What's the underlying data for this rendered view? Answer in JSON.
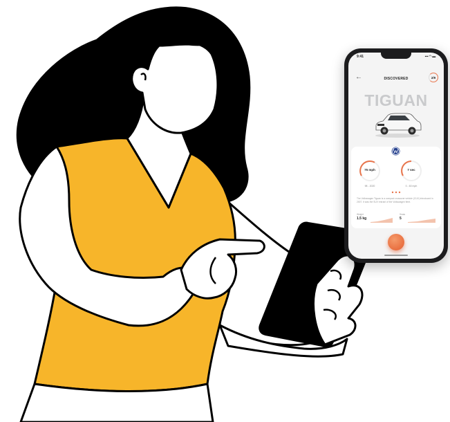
{
  "phone": {
    "status_time": "9:41",
    "status_right": "▪▪▪ ◠ ▬",
    "back_icon": "←",
    "header_title": "DISCOVERED",
    "page_indicator": "2/9",
    "model_name": "TIGUAN",
    "brand_icon": "vw-logo",
    "gauges": [
      {
        "value": "75 mph",
        "caption": "98 - 2020"
      },
      {
        "value": "7 sec",
        "caption": "0 - 60 mph"
      }
    ],
    "description": "The Volkswagen Tiguan is a compact crossover vehicle (CUV) introduced in 2007. It was the SUV entrant of the Volkswagen fleet.",
    "stats": [
      {
        "label": "Weight",
        "value": "1.5 kg"
      },
      {
        "label": "Seats",
        "value": "5"
      }
    ],
    "accent_color": "#e8744b"
  },
  "illustration": {
    "shirt_color": "#f7b52a",
    "hair_color": "#000000",
    "tablet_color": "#000000"
  }
}
